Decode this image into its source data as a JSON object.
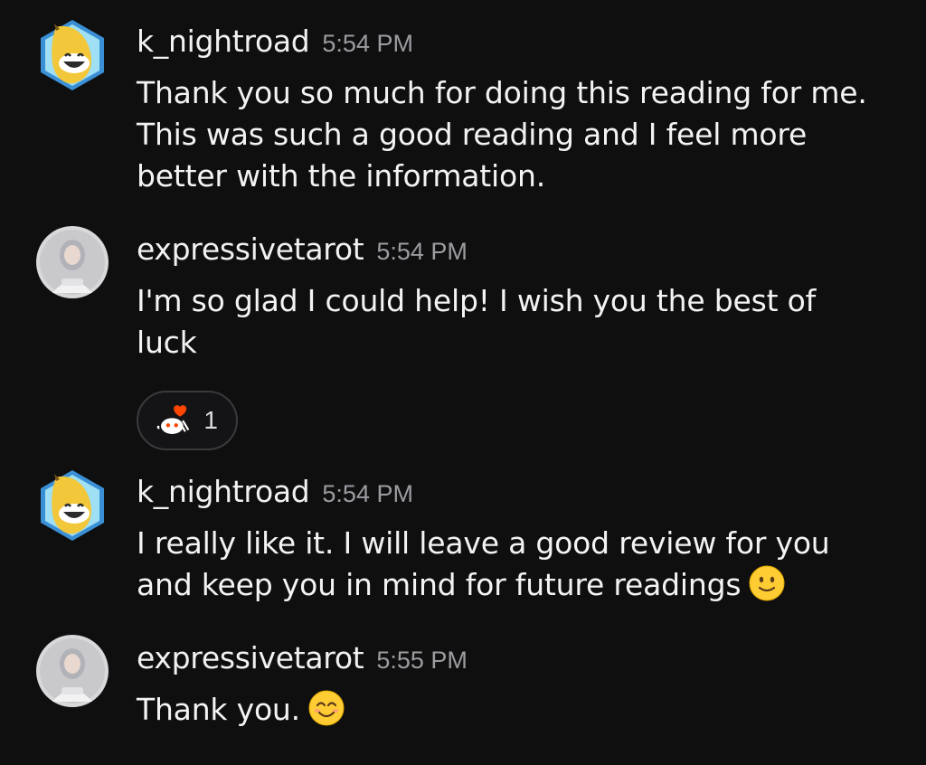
{
  "messages": [
    {
      "author": "k_nightroad",
      "avatar_icon": "banana-character-avatar-icon",
      "time": "5:54 PM",
      "lines": [
        "Thank you so much for doing this reading for me.",
        "This was such a good reading and I feel more",
        "better with the information."
      ]
    },
    {
      "author": "expressivetarot",
      "avatar_icon": "person-photo-avatar-icon",
      "time": "5:54 PM",
      "lines": [
        "I'm so glad I could help! I wish you the best of",
        "luck"
      ],
      "reaction": {
        "icon": "snoo-heart-icon",
        "count": "1"
      }
    },
    {
      "author": "k_nightroad",
      "avatar_icon": "banana-character-avatar-icon",
      "time": "5:54 PM",
      "lines": [
        "I really like it. I will leave a good review for you",
        "and keep you in mind for future readings"
      ],
      "emoji": "slightly-smiling-face-icon"
    },
    {
      "author": "expressivetarot",
      "avatar_icon": "person-photo-avatar-icon",
      "time": "5:55 PM",
      "lines": [
        "Thank you."
      ],
      "emoji": "smiling-face-with-smiling-eyes-icon"
    }
  ],
  "colors": {
    "background": "#0f0f10",
    "text": "#f3f3f4",
    "timestamp": "#9c9ca1",
    "avatar_ring": "#3b8fd4"
  }
}
